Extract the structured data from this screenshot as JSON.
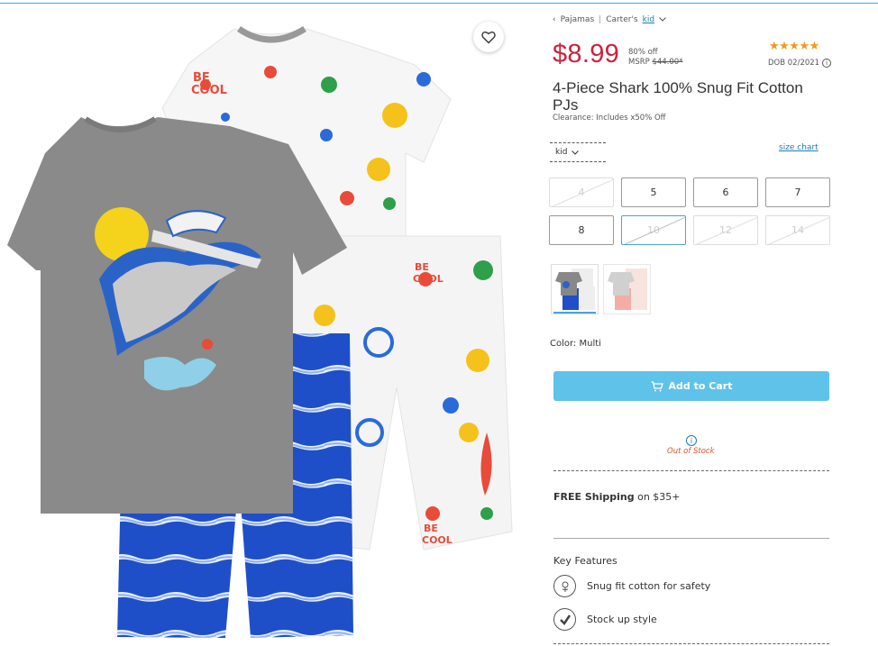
{
  "breadcrumb": {
    "back_label": "Pajamas",
    "brand": "Carter's",
    "sub_link": "kid"
  },
  "price": {
    "current": "$8.99",
    "discount": "80% off",
    "msrp_label": "MSRP",
    "msrp_value": "$44.00*",
    "stars": "★★★★★",
    "rating": 5,
    "dob": "DOB 02/2021"
  },
  "product": {
    "title": "4-Piece Shark 100% Snug Fit Cotton PJs",
    "clearance": "Clearance: Includes x50% Off"
  },
  "size_selector": {
    "type_label": "kid",
    "size_chart_label": "size chart"
  },
  "sizes": [
    {
      "label": "4",
      "available": false,
      "selected": false
    },
    {
      "label": "5",
      "available": true,
      "selected": false
    },
    {
      "label": "6",
      "available": true,
      "selected": false
    },
    {
      "label": "7",
      "available": true,
      "selected": false
    },
    {
      "label": "8",
      "available": true,
      "selected": false
    },
    {
      "label": "10",
      "available": false,
      "selected": true
    },
    {
      "label": "12",
      "available": false,
      "selected": false
    },
    {
      "label": "14",
      "available": false,
      "selected": false
    }
  ],
  "color": {
    "label": "Color: Multi"
  },
  "cart": {
    "button_label": "Add to Cart",
    "stock_status": "Out of Stock"
  },
  "shipping": {
    "bold": "FREE Shipping",
    "rest": " on $35+"
  },
  "features": {
    "title": "Key Features",
    "items": [
      {
        "label": "Snug fit cotton for safety",
        "icon": "cotton-flower-icon"
      },
      {
        "label": "Stock up style",
        "icon": "checkmark-icon"
      }
    ]
  },
  "theme": {
    "price_red": "#d0203a",
    "accent_blue": "#5fc2e9",
    "link_blue": "#1f7ab8",
    "star_orange": "#f09a1a",
    "oos_orange": "#e0522b"
  }
}
